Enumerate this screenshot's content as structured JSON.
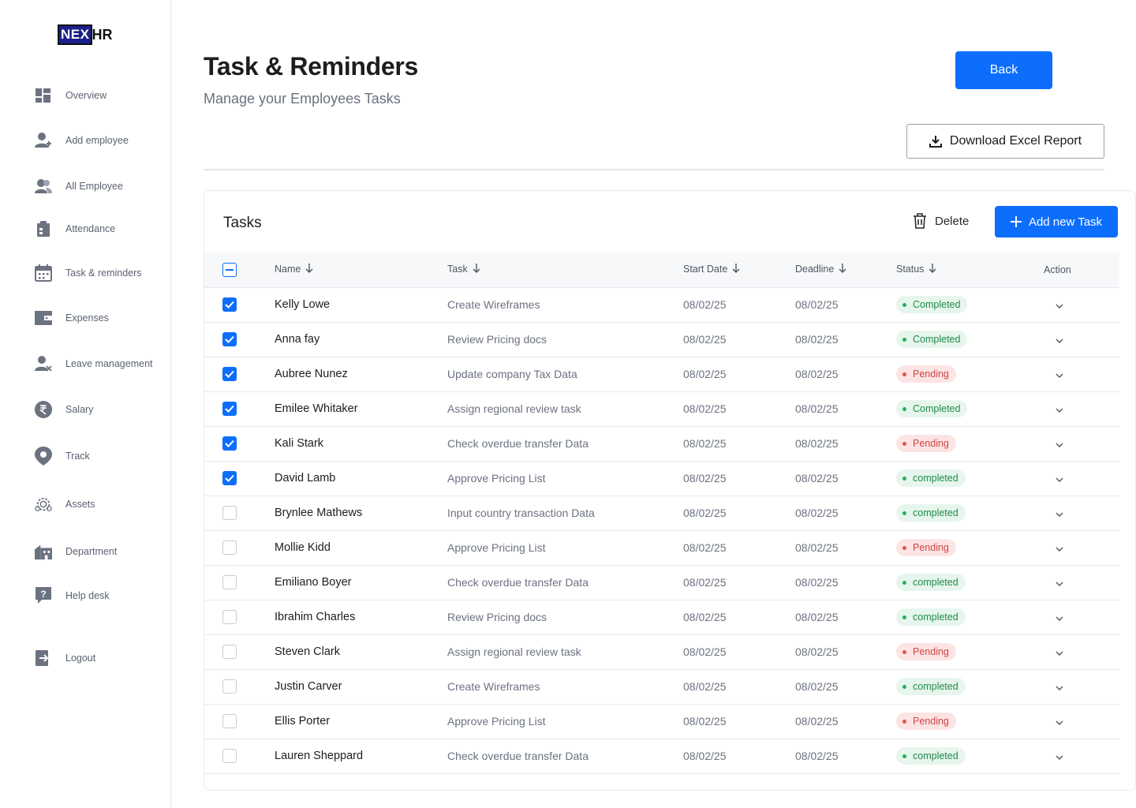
{
  "logo": {
    "part1": "NEX",
    "part2": "HR"
  },
  "sidebar": {
    "items": [
      {
        "label": "Overview",
        "icon": "dashboard-icon"
      },
      {
        "label": "Add employee",
        "icon": "add-user-icon"
      },
      {
        "label": "All Employee",
        "icon": "users-icon"
      },
      {
        "label": "Attendance",
        "icon": "clipboard-icon"
      },
      {
        "label": "Task & reminders",
        "icon": "calendar-icon"
      },
      {
        "label": "Expenses",
        "icon": "wallet-icon"
      },
      {
        "label": "Leave management",
        "icon": "user-remove-icon"
      },
      {
        "label": "Salary",
        "icon": "rupee-icon"
      },
      {
        "label": "Track",
        "icon": "location-pin-icon"
      },
      {
        "label": "Assets",
        "icon": "assets-gear-icon"
      },
      {
        "label": "Department",
        "icon": "building-icon"
      },
      {
        "label": "Help desk",
        "icon": "help-icon"
      },
      {
        "label": "Logout",
        "icon": "logout-icon"
      }
    ]
  },
  "header": {
    "title": "Task & Reminders",
    "subtitle": "Manage your Employees Tasks",
    "back_label": "Back",
    "download_label": "Download Excel Report"
  },
  "panel": {
    "title": "Tasks",
    "delete_label": "Delete",
    "add_label": "Add new Task"
  },
  "table": {
    "columns": [
      "Name",
      "Task",
      "Start Date",
      "Deadline",
      "Status",
      "Action"
    ],
    "rows": [
      {
        "checked": true,
        "name": "Kelly Lowe",
        "task": "Create Wireframes",
        "start": "08/02/25",
        "deadline": "08/02/25",
        "status": "Completed",
        "status_type": "ok"
      },
      {
        "checked": true,
        "name": "Anna fay",
        "task": "Review Pricing docs",
        "start": "08/02/25",
        "deadline": "08/02/25",
        "status": "Completed",
        "status_type": "ok"
      },
      {
        "checked": true,
        "name": "Aubree Nunez",
        "task": "Update company Tax Data",
        "start": "08/02/25",
        "deadline": "08/02/25",
        "status": "Pending",
        "status_type": "pend"
      },
      {
        "checked": true,
        "name": "Emilee Whitaker",
        "task": "Assign regional review task",
        "start": "08/02/25",
        "deadline": "08/02/25",
        "status": "Completed",
        "status_type": "ok"
      },
      {
        "checked": true,
        "name": "Kali Stark",
        "task": "Check overdue transfer Data",
        "start": "08/02/25",
        "deadline": "08/02/25",
        "status": "Pending",
        "status_type": "pend"
      },
      {
        "checked": true,
        "name": "David Lamb",
        "task": "Approve Pricing List",
        "start": "08/02/25",
        "deadline": "08/02/25",
        "status": "completed",
        "status_type": "ok"
      },
      {
        "checked": false,
        "name": "Brynlee Mathews",
        "task": "Input country transaction Data",
        "start": "08/02/25",
        "deadline": "08/02/25",
        "status": "completed",
        "status_type": "ok"
      },
      {
        "checked": false,
        "name": "Mollie Kidd",
        "task": "Approve Pricing List",
        "start": "08/02/25",
        "deadline": "08/02/25",
        "status": "Pending",
        "status_type": "pend"
      },
      {
        "checked": false,
        "name": "Emiliano Boyer",
        "task": "Check overdue transfer Data",
        "start": "08/02/25",
        "deadline": "08/02/25",
        "status": "completed",
        "status_type": "ok"
      },
      {
        "checked": false,
        "name": "Ibrahim Charles",
        "task": "Review Pricing docs",
        "start": "08/02/25",
        "deadline": "08/02/25",
        "status": "completed",
        "status_type": "ok"
      },
      {
        "checked": false,
        "name": "Steven Clark",
        "task": "Assign regional review task",
        "start": "08/02/25",
        "deadline": "08/02/25",
        "status": "Pending",
        "status_type": "pend"
      },
      {
        "checked": false,
        "name": "Justin Carver",
        "task": "Create Wireframes",
        "start": "08/02/25",
        "deadline": "08/02/25",
        "status": "completed",
        "status_type": "ok"
      },
      {
        "checked": false,
        "name": "Ellis Porter",
        "task": "Approve Pricing List",
        "start": "08/02/25",
        "deadline": "08/02/25",
        "status": "Pending",
        "status_type": "pend"
      },
      {
        "checked": false,
        "name": "Lauren Sheppard",
        "task": "Check overdue transfer Data",
        "start": "08/02/25",
        "deadline": "08/02/25",
        "status": "completed",
        "status_type": "ok"
      }
    ]
  },
  "colors": {
    "accent": "#0d6efd",
    "completed": "#1f8a4c",
    "pending": "#d04444",
    "sidebar_icon": "#6b7280"
  }
}
